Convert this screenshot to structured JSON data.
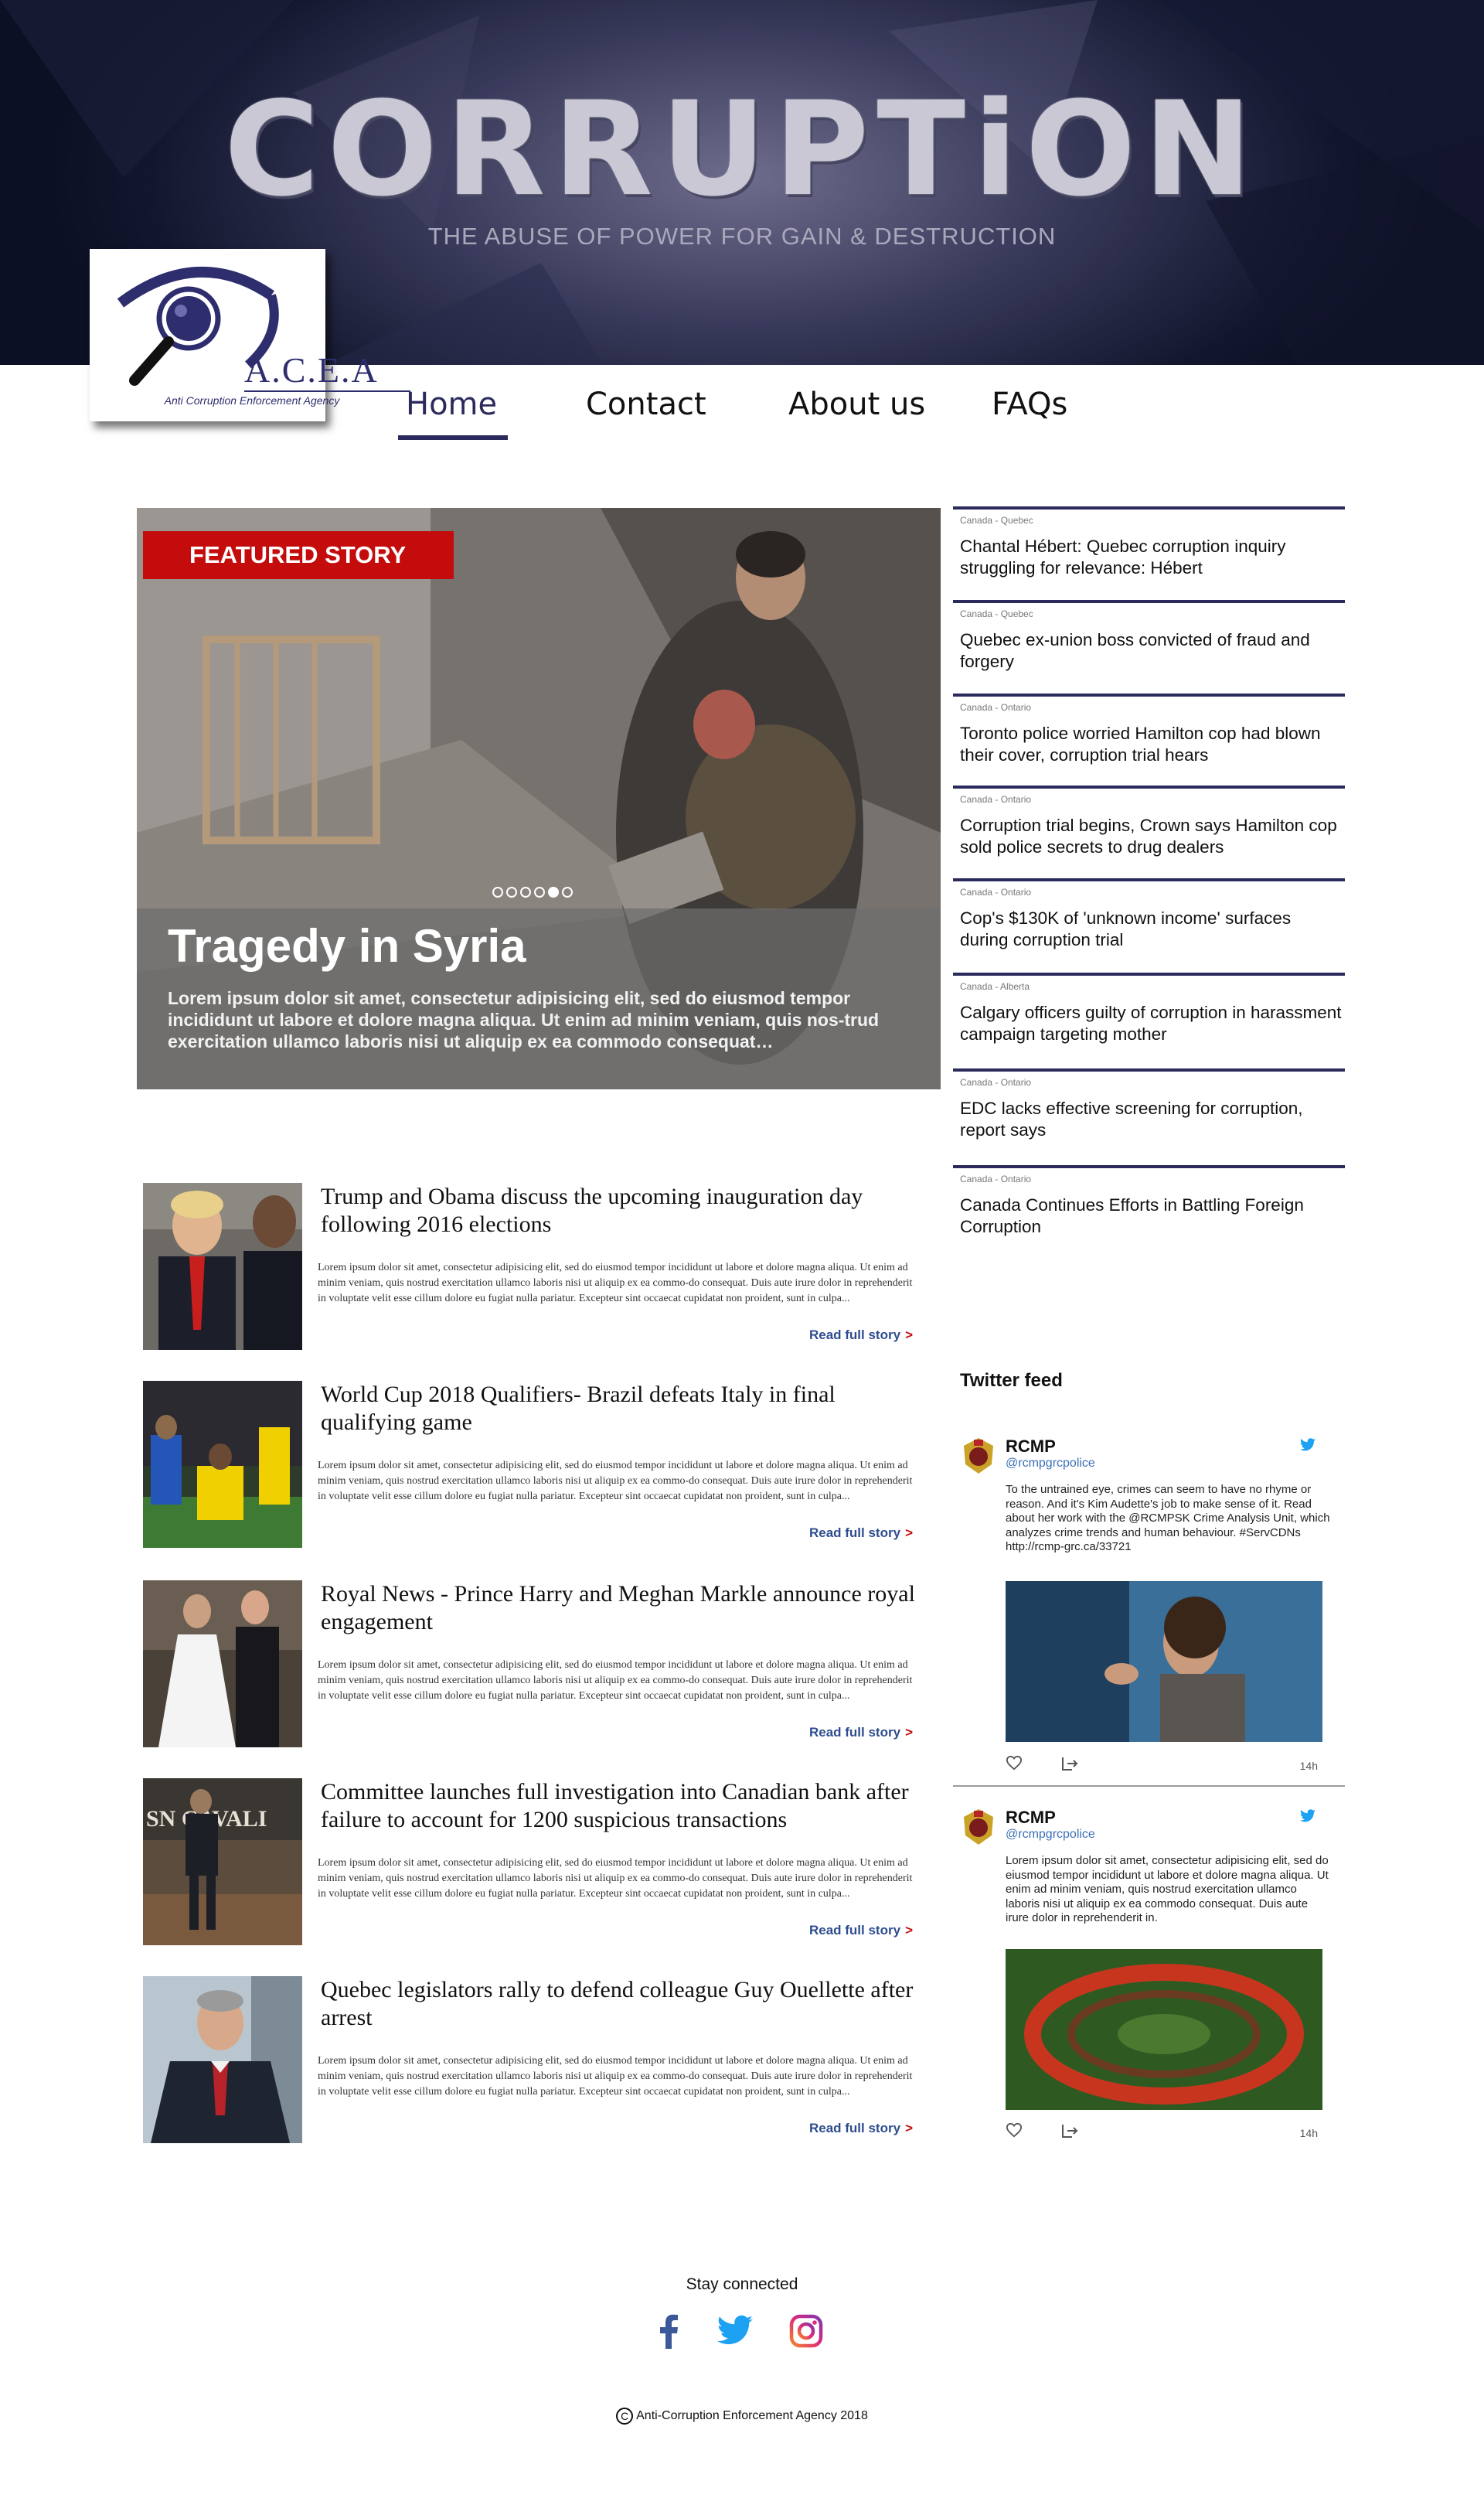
{
  "header": {
    "title": "CORRUPTiON",
    "tagline": "THE ABUSE OF POWER FOR GAIN & DESTRUCTION"
  },
  "logo": {
    "abbreviation": "A.C.E.A",
    "subtitle": "Anti Corruption Enforcement Agency"
  },
  "nav": {
    "items": [
      {
        "label": "Home",
        "active": true
      },
      {
        "label": "Contact",
        "active": false
      },
      {
        "label": "About us",
        "active": false
      },
      {
        "label": "FAQs",
        "active": false
      }
    ]
  },
  "featured": {
    "badge": "FEATURED STORY",
    "title": "Tragedy in Syria",
    "text": "Lorem ipsum dolor sit amet, consectetur adipisicing elit, sed do eiusmod tempor incididunt ut labore et dolore magna aliqua. Ut enim ad minim veniam, quis nos-trud exercitation ullamco laboris nisi ut aliquip ex ea commodo consequat…",
    "slides": 6,
    "active_slide": 5
  },
  "headlines": [
    {
      "region": "Canada - Quebec",
      "title": "Chantal Hébert: Quebec corruption inquiry struggling for relevance: Hébert"
    },
    {
      "region": "Canada - Quebec",
      "title": "Quebec ex-union boss convicted of fraud and forgery"
    },
    {
      "region": "Canada - Ontario",
      "title": "Toronto police worried Hamilton cop had blown their cover, corruption trial hears"
    },
    {
      "region": "Canada - Ontario",
      "title": "Corruption trial begins, Crown says Hamilton cop sold police secrets to drug dealers"
    },
    {
      "region": "Canada - Ontario",
      "title": "Cop's $130K of 'unknown income' surfaces during corruption trial"
    },
    {
      "region": "Canada - Alberta",
      "title": "Calgary officers guilty of corruption in harassment campaign targeting mother"
    },
    {
      "region": "Canada - Ontario",
      "title": "EDC lacks effective screening for corruption, report says"
    },
    {
      "region": "Canada - Ontario",
      "title": "Canada Continues Efforts in Battling Foreign Corruption"
    }
  ],
  "articles": [
    {
      "title": "Trump and Obama discuss the upcoming inauguration day following 2016 elections",
      "text": "Lorem ipsum dolor sit amet, consectetur adipisicing elit, sed do eiusmod tempor incididunt ut labore et dolore magna aliqua. Ut enim ad minim veniam, quis nostrud exercitation ullamco laboris nisi ut aliquip ex ea commo-do consequat. Duis aute irure dolor in reprehenderit in voluptate velit esse cillum dolore eu fugiat nulla pariatur. Excepteur sint occaecat cupidatat non proident, sunt in culpa...",
      "link": "Read full story"
    },
    {
      "title": "World Cup 2018 Qualifiers- Brazil defeats Italy in final qualifying game",
      "text": "Lorem ipsum dolor sit amet, consectetur adipisicing elit, sed do eiusmod tempor incididunt ut labore et dolore magna aliqua. Ut enim ad minim veniam, quis nostrud exercitation ullamco laboris nisi ut aliquip ex ea commo-do consequat. Duis aute irure dolor in reprehenderit in voluptate velit esse cillum dolore eu fugiat nulla pariatur. Excepteur sint occaecat cupidatat non proident, sunt in culpa...",
      "link": "Read full story"
    },
    {
      "title": "Royal News - Prince Harry and Meghan Markle announce royal engagement",
      "text": "Lorem ipsum dolor sit amet, consectetur adipisicing elit, sed do eiusmod tempor incididunt ut labore et dolore magna aliqua. Ut enim ad minim veniam, quis nostrud exercitation ullamco laboris nisi ut aliquip ex ea commo-do consequat. Duis aute irure dolor in reprehenderit in voluptate velit esse cillum dolore eu fugiat nulla pariatur. Excepteur sint occaecat cupidatat non proident, sunt in culpa...",
      "link": "Read full story"
    },
    {
      "title": "Committee launches full investigation into Canadian bank after failure to account for 1200 suspicious transactions",
      "text": "Lorem ipsum dolor sit amet, consectetur adipisicing elit, sed do eiusmod tempor incididunt ut labore et dolore magna aliqua. Ut enim ad minim veniam, quis nostrud exercitation ullamco laboris nisi ut aliquip ex ea commo-do consequat. Duis aute irure dolor in reprehenderit in voluptate velit esse cillum dolore eu fugiat nulla pariatur. Excepteur sint occaecat cupidatat non proident, sunt in culpa...",
      "link": "Read full story"
    },
    {
      "title": "Quebec legislators rally to defend colleague Guy Ouellette after arrest",
      "text": "Lorem ipsum dolor sit amet, consectetur adipisicing elit, sed do eiusmod tempor incididunt ut labore et dolore magna aliqua. Ut enim ad minim veniam, quis nostrud exercitation ullamco laboris nisi ut aliquip ex ea commo-do consequat. Duis aute irure dolor in reprehenderit in voluptate velit esse cillum dolore eu fugiat nulla pariatur. Excepteur sint occaecat cupidatat non proident, sunt in culpa...",
      "link": "Read full story"
    }
  ],
  "twitter": {
    "label": "Twitter feed",
    "tweets": [
      {
        "name": "RCMP",
        "handle": "@rcmpgrcpolice",
        "text": "To the untrained eye, crimes can seem to have no rhyme or reason. And it's Kim Audette's job to make sense of it. Read about her work with the @RCMPSK Crime Analysis Unit, which analyzes crime trends and human behaviour. #ServCDNs http://rcmp-grc.ca/33721",
        "time": "14h"
      },
      {
        "name": "RCMP",
        "handle": "@rcmpgrcpolice",
        "text": "Lorem ipsum dolor sit amet, consectetur adipisicing elit, sed do eiusmod tempor incididunt ut labore et dolore magna aliqua. Ut enim ad minim veniam, quis nostrud exercitation ullamco laboris nisi ut aliquip ex ea commodo consequat. Duis aute irure dolor in reprehenderit in.",
        "time": "14h"
      }
    ]
  },
  "footer": {
    "stay_connected": "Stay connected",
    "social": [
      "facebook-icon",
      "twitter-icon",
      "instagram-icon"
    ],
    "copyright_mark": "C",
    "copyright": "Anti-Corruption Enforcement Agency 2018"
  },
  "colors": {
    "brand_navy": "#2b2a5c",
    "featured_red": "#c40c0c",
    "link_blue": "#2e4d8f",
    "twitter_blue": "#1da1f2",
    "facebook_blue": "#3b5998",
    "instagram_pink": "#c13584"
  }
}
